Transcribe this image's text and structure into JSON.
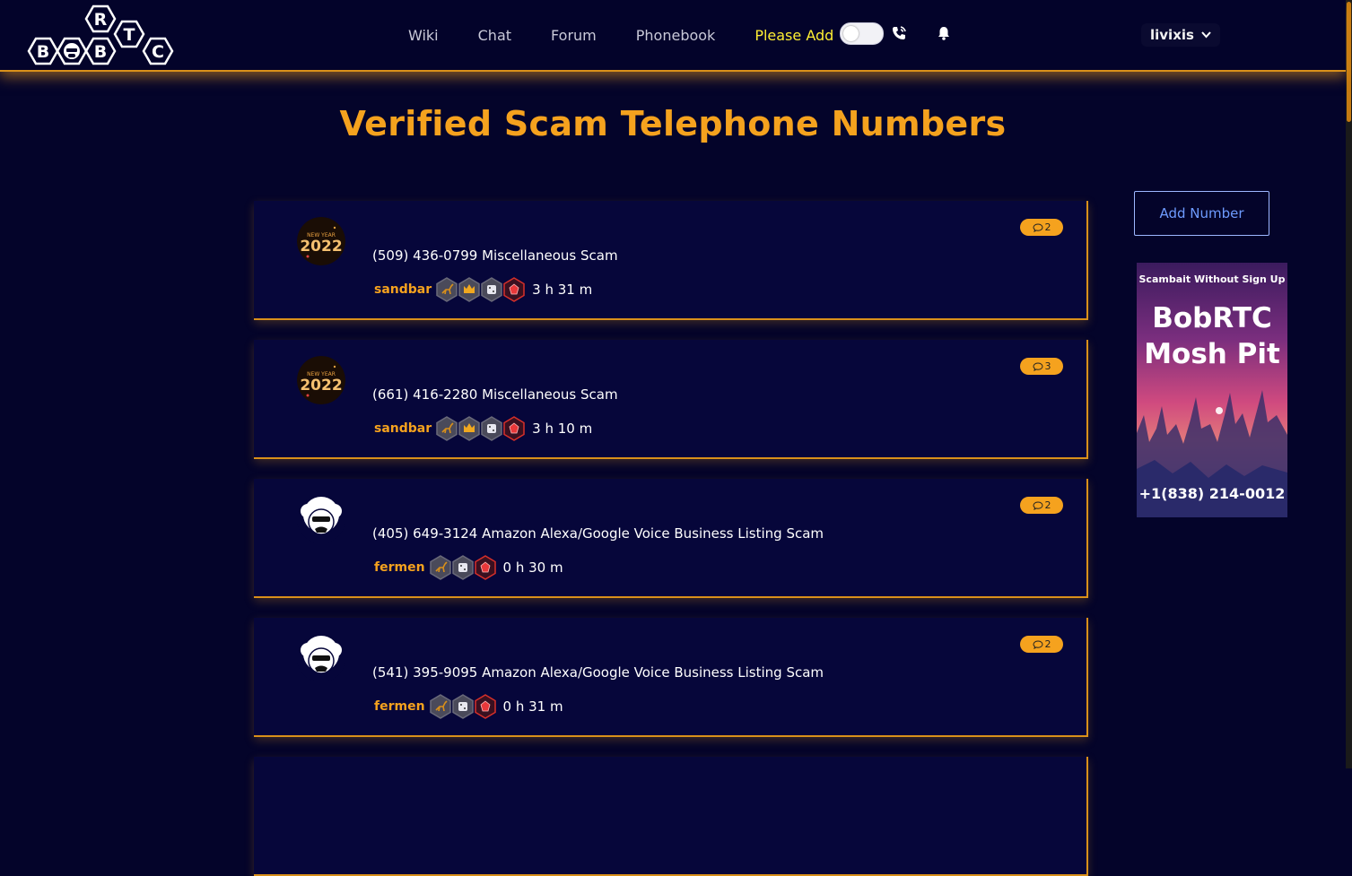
{
  "nav": {
    "logo_letters": [
      "B",
      "B",
      "R",
      "T",
      "C"
    ],
    "links": [
      "Wiki",
      "Chat",
      "Forum",
      "Phonebook"
    ],
    "highlight_link": "Please Add",
    "username": "livixis"
  },
  "page": {
    "title": "Verified Scam Telephone Numbers"
  },
  "listings": [
    {
      "title": "(509) 436-0799 Miscellaneous Scam",
      "user": "sandbar",
      "time": "3 h 31 m",
      "comments": "2",
      "avatar": "new-year-2022"
    },
    {
      "title": "(661) 416-2280 Miscellaneous Scam",
      "user": "sandbar",
      "time": "3 h 10 m",
      "comments": "3",
      "avatar": "new-year-2022"
    },
    {
      "title": "(405) 649-3124 Amazon Alexa/Google Voice Business Listing Scam",
      "user": "fermen",
      "time": "0 h 30 m",
      "comments": "2",
      "avatar": "bob-afro"
    },
    {
      "title": "(541) 395-9095 Amazon Alexa/Google Voice Business Listing Scam",
      "user": "fermen",
      "time": "0 h 31 m",
      "comments": "2",
      "avatar": "bob-afro"
    }
  ],
  "avatar_text": {
    "new_year": "NEW YEAR",
    "year": "2022"
  },
  "sidebar": {
    "add_button": "Add Number",
    "ad": {
      "top": "Scambait Without Sign Up",
      "line1": "BobRTC",
      "line2": "Mosh Pit",
      "phone": "+1(838) 214-0012"
    }
  },
  "colors": {
    "accent": "#f5a21e",
    "highlight": "#ffee33",
    "background": "#04042a",
    "link_blue": "#6e9bff"
  }
}
